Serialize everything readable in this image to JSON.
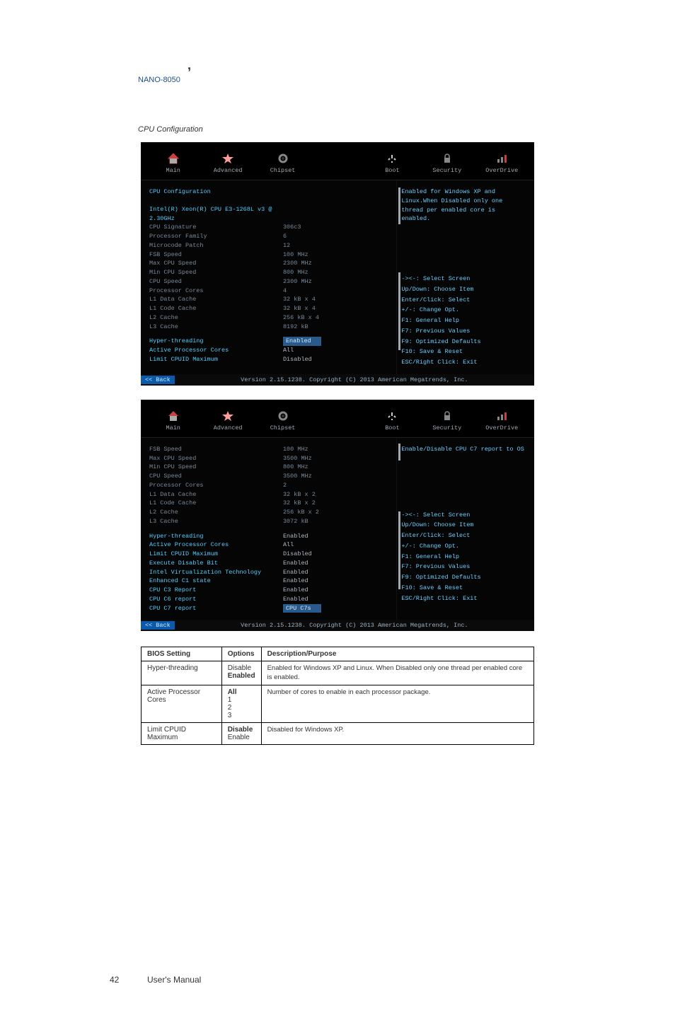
{
  "doc": {
    "comma": ",",
    "nano8050_title": "NANO-8050",
    "section_label": "CPU Configuration",
    "footer": "User's Manual",
    "page_num": "42"
  },
  "tabs": [
    "Main",
    "Advanced",
    "Chipset",
    "",
    "Boot",
    "Security",
    "OverDrive"
  ],
  "shot1": {
    "section_title": "CPU Configuration",
    "cpu_model": "Intel(R) Xeon(R) CPU E3-1268L v3 @ 2.30GHz",
    "info": [
      {
        "label": "CPU Signature",
        "value": "306c3"
      },
      {
        "label": "Processor Family",
        "value": "6"
      },
      {
        "label": "Microcode Patch",
        "value": "12"
      },
      {
        "label": "FSB Speed",
        "value": "100 MHz"
      },
      {
        "label": "Max CPU Speed",
        "value": "2300 MHz"
      },
      {
        "label": "Min CPU Speed",
        "value": "800 MHz"
      },
      {
        "label": "CPU Speed",
        "value": "2300 MHz"
      },
      {
        "label": "Processor Cores",
        "value": "4"
      },
      {
        "label": "L1 Data Cache",
        "value": "32 kB x 4"
      },
      {
        "label": "L1 Code Cache",
        "value": "32 kB x 4"
      },
      {
        "label": "L2 Cache",
        "value": "256 kB x 4"
      },
      {
        "label": "L3 Cache",
        "value": "8192 kB"
      }
    ],
    "opts": [
      {
        "label": "Hyper-threading",
        "value": "Enabled",
        "sel": true
      },
      {
        "label": "Active Processor Cores",
        "value": "All"
      },
      {
        "label": "Limit CPUID Maximum",
        "value": "Disabled"
      }
    ],
    "help_top": "Enabled for Windows XP and Linux.When Disabled only one thread per enabled core is enabled.",
    "back_label": "<< Back",
    "copyright": "Version 2.15.1238. Copyright (C) 2013 American Megatrends, Inc."
  },
  "shot2": {
    "info": [
      {
        "label": "FSB Speed",
        "value": "100 MHz"
      },
      {
        "label": "Max CPU Speed",
        "value": "3500 MHz"
      },
      {
        "label": "Min CPU Speed",
        "value": "800 MHz"
      },
      {
        "label": "CPU Speed",
        "value": "3500 MHz"
      },
      {
        "label": "Processor Cores",
        "value": "2"
      },
      {
        "label": "L1 Data Cache",
        "value": "32 kB x 2"
      },
      {
        "label": "L1 Code Cache",
        "value": "32 kB x 2"
      },
      {
        "label": "L2 Cache",
        "value": "256 kB x 2"
      },
      {
        "label": "L3 Cache",
        "value": "3072 kB"
      }
    ],
    "opts": [
      {
        "label": "Hyper-threading",
        "value": "Enabled"
      },
      {
        "label": "Active Processor Cores",
        "value": "All"
      },
      {
        "label": "Limit CPUID Maximum",
        "value": "Disabled"
      },
      {
        "label": "Execute Disable Bit",
        "value": "Enabled"
      },
      {
        "label": "Intel Virtualization Technology",
        "value": "Enabled"
      },
      {
        "label": "  Enhanced C1 state",
        "value": "Enabled"
      },
      {
        "label": "  CPU C3 Report",
        "value": "Enabled"
      },
      {
        "label": "  CPU C6 report",
        "value": "Enabled"
      },
      {
        "label": "  CPU C7 report",
        "value": "CPU C7s",
        "sel": true
      }
    ],
    "help_top": "Enable/Disable CPU C7 report to OS",
    "back_label": "<< Back",
    "copyright": "Version 2.15.1238. Copyright (C) 2013 American Megatrends, Inc."
  },
  "keys": [
    "-><-: Select Screen",
    "Up/Down: Choose Item",
    "Enter/Click: Select",
    "+/-: Change Opt.",
    "F1:  General Help",
    "F7:  Previous Values",
    "F9:  Optimized Defaults",
    "F10: Save & Reset",
    "ESC/Right Click: Exit"
  ],
  "table": {
    "headers": [
      "BIOS Setting",
      "Options",
      "Description/Purpose"
    ],
    "rows": [
      {
        "setting": "Hyper-threading",
        "options": "Disable\nEnabled",
        "default": "Enabled",
        "desc": "Enabled for Windows XP and Linux. When Disabled only one thread per enabled core is enabled."
      },
      {
        "setting": "Active Processor Cores",
        "options": "All\n1\n2\n3",
        "default": "All",
        "desc": "Number of cores to enable in each processor package."
      },
      {
        "setting": "Limit CPUID Maximum",
        "options": "Disable\nEnable",
        "default": "Disable",
        "desc": "Disabled for Windows XP."
      }
    ]
  }
}
